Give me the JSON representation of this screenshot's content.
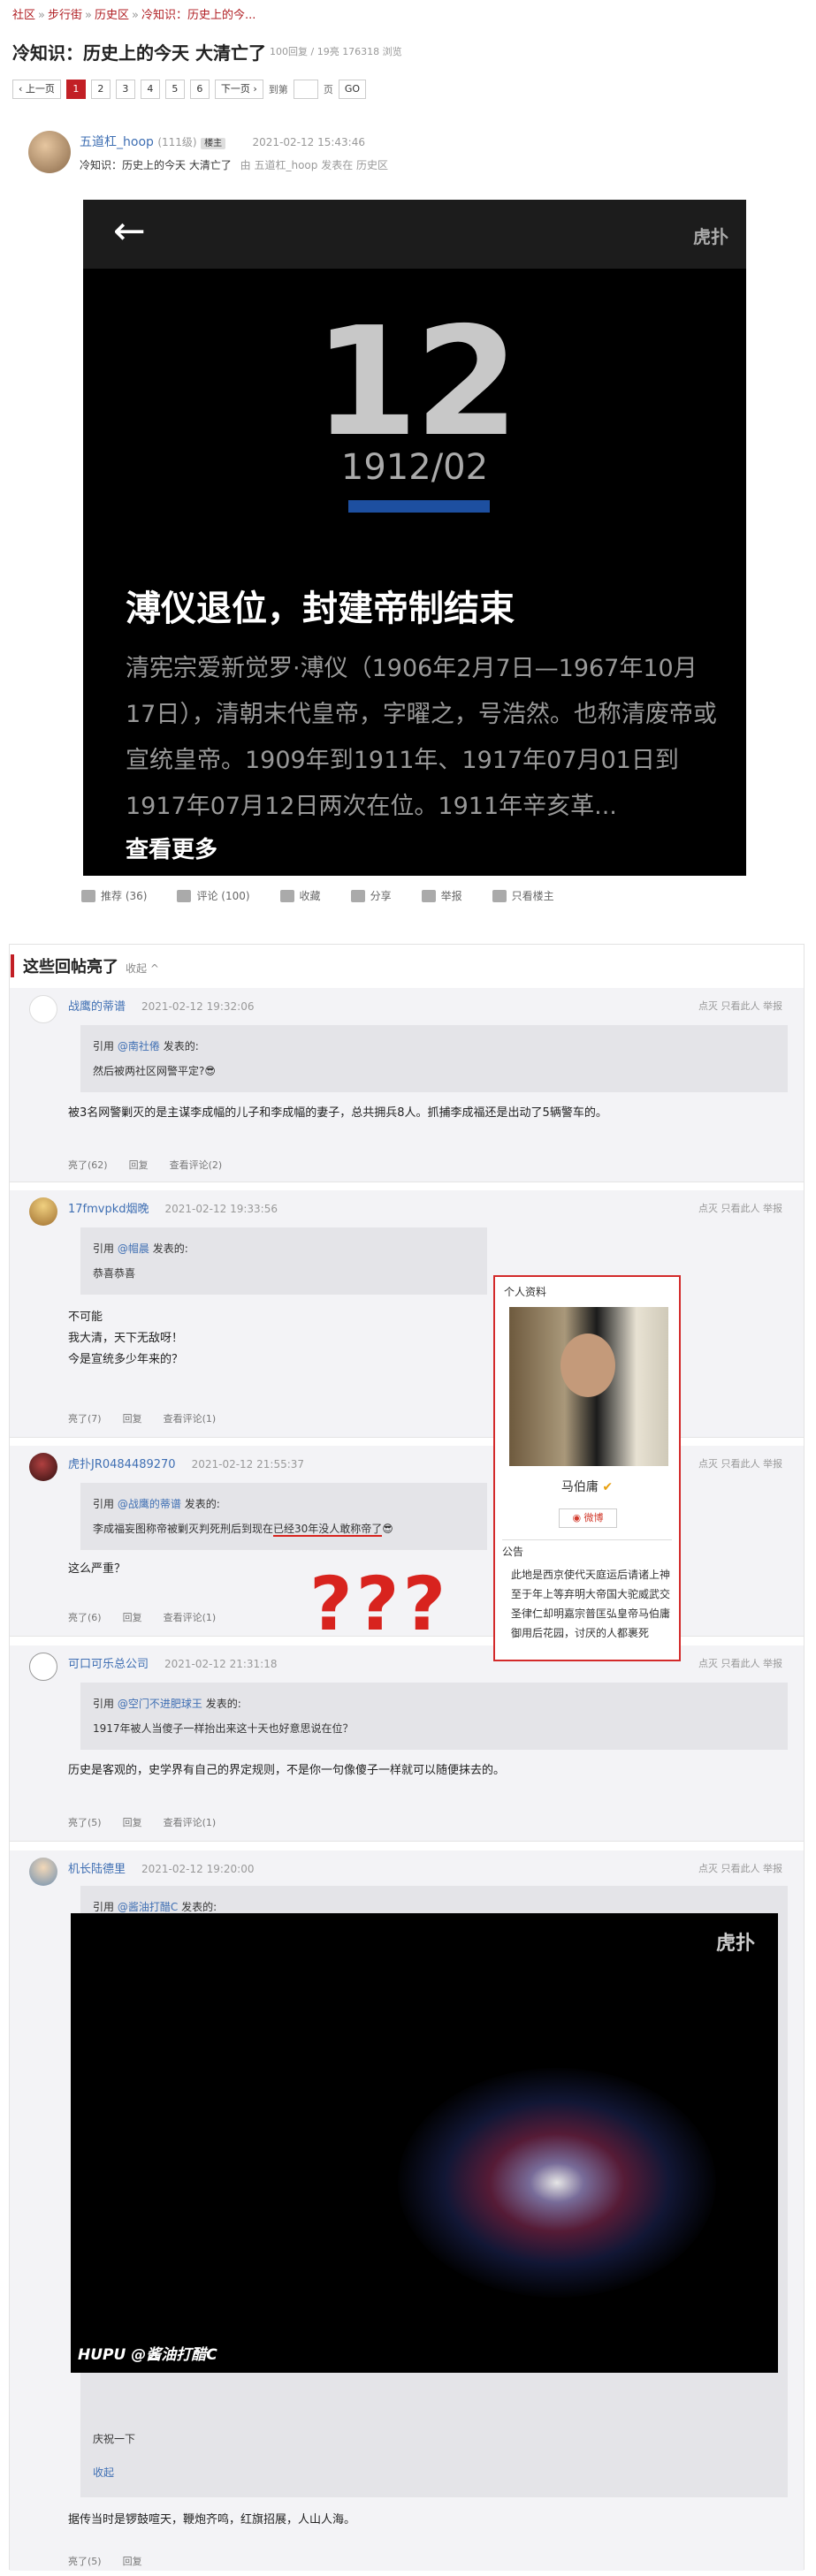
{
  "breadcrumb": {
    "items": [
      "社区",
      "步行街",
      "历史区",
      "冷知识：历史上的今..."
    ],
    "sep": "»"
  },
  "thread": {
    "title": "冷知识：历史上的今天 大清亡了",
    "meta": "100回复 / 19亮 176318 浏览"
  },
  "pager": {
    "prev": "‹ 上一页",
    "pages": [
      "1",
      "2",
      "3",
      "4",
      "5",
      "6"
    ],
    "next": "下一页 ›",
    "goto": "到第",
    "page_unit": "页",
    "go": "GO"
  },
  "op": {
    "name": "五道杠_hoop",
    "level": "(111级)",
    "badge": "楼主",
    "time": "2021-02-12 15:43:46",
    "subtitle": "冷知识：历史上的今天 大清亡了",
    "from": "由 五道杠_hoop 发表在 历史区"
  },
  "main_image": {
    "day": "12",
    "ym": "1912/02",
    "brand": "虎扑",
    "headline": "溥仪退位，封建帝制结束",
    "desc": "清宪宗爱新觉罗·溥仪（1906年2月7日—1967年10月17日），清朝末代皇帝，字曜之，号浩然。也称清废帝或宣统皇帝。1909年到1911年、1917年07月01日到1917年07月12日两次在位。1911年辛亥革...",
    "more": "查看更多"
  },
  "actions": [
    "推荐 (36)",
    "评论 (100)",
    "收藏",
    "分享",
    "举报",
    "只看楼主"
  ],
  "hot": {
    "title": "这些回帖亮了",
    "collapse": "收起 ^"
  },
  "tools": "点灭  只看此人  举报",
  "replies": [
    {
      "name": "战鹰的蒂谱",
      "time": "2021-02-12 19:32:06",
      "quote_user": "@南社倦",
      "quote_text": "然后被两社区网警平定?😎",
      "text": "被3名网警剿灭的是主谋李成幅的儿子和李成幅的妻子，总共拥兵8人。抓捕李成福还是出动了5辆警车的。",
      "foot": [
        "亮了(62)",
        "回复",
        "查看评论(2)"
      ]
    },
    {
      "name": "17fmvpkd烟晚",
      "time": "2021-02-12 19:33:56",
      "quote_user": "@帽晨",
      "quote_text": "恭喜恭喜",
      "text_lines": [
        "不可能",
        "我大清，天下无敌呀！",
        "今是宣统多少年来的？"
      ],
      "foot": [
        "亮了(7)",
        "回复",
        "查看评论(1)"
      ]
    },
    {
      "name": "虎扑JR0484489270",
      "time": "2021-02-12 21:55:37",
      "quote_user": "@战鹰的蒂谱",
      "quote_text_a": "李成福妄图称帝被剿灭判死刑后到现在",
      "quote_text_b": "已经30年没人敢称帝了",
      "quote_emoji": "😎",
      "text": "这么严重？",
      "foot": [
        "亮了(6)",
        "回复",
        "查看评论(1)"
      ]
    },
    {
      "name": "可口可乐总公司",
      "time": "2021-02-12 21:31:18",
      "quote_user": "@空门不进肥球王",
      "quote_text": "1917年被人当傻子一样抬出来这十天也好意思说在位？",
      "text": "历史是客观的，史学界有自己的界定规则，不是你一句像傻子一样就可以随便抹去的。",
      "foot": [
        "亮了(5)",
        "回复",
        "查看评论(1)"
      ]
    },
    {
      "name": "机长陆德里",
      "time": "2021-02-12 19:20:00",
      "quote_user": "@酱油打醋C",
      "fw_brand": "虎扑",
      "fw_watermark": "HUPU @酱油打醋C",
      "quote_text": "庆祝一下",
      "quote_collapse": "收起",
      "text": "据传当时是锣鼓喧天，鞭炮齐鸣，红旗招展，人山人海。",
      "foot": [
        "亮了(5)",
        "回复"
      ]
    }
  ],
  "quote_prefix": "引用",
  "quote_suffix": "发表的:",
  "profile": {
    "header": "个人资料",
    "name": "马伯庸",
    "weibo": "微博",
    "notice_title": "公告",
    "notice": "此地是西京使代天庭运后请诸上神至于年上等弃明大帝国大驼威武交圣律仁却明嘉宗普匡弘皇帝马伯庸御用后花园，讨厌的人都裹死"
  },
  "annotation": {
    "marks": "???"
  },
  "colors": {
    "accent": "#c21f25",
    "link": "#3f6fb3",
    "highlight": "#d8231e"
  }
}
